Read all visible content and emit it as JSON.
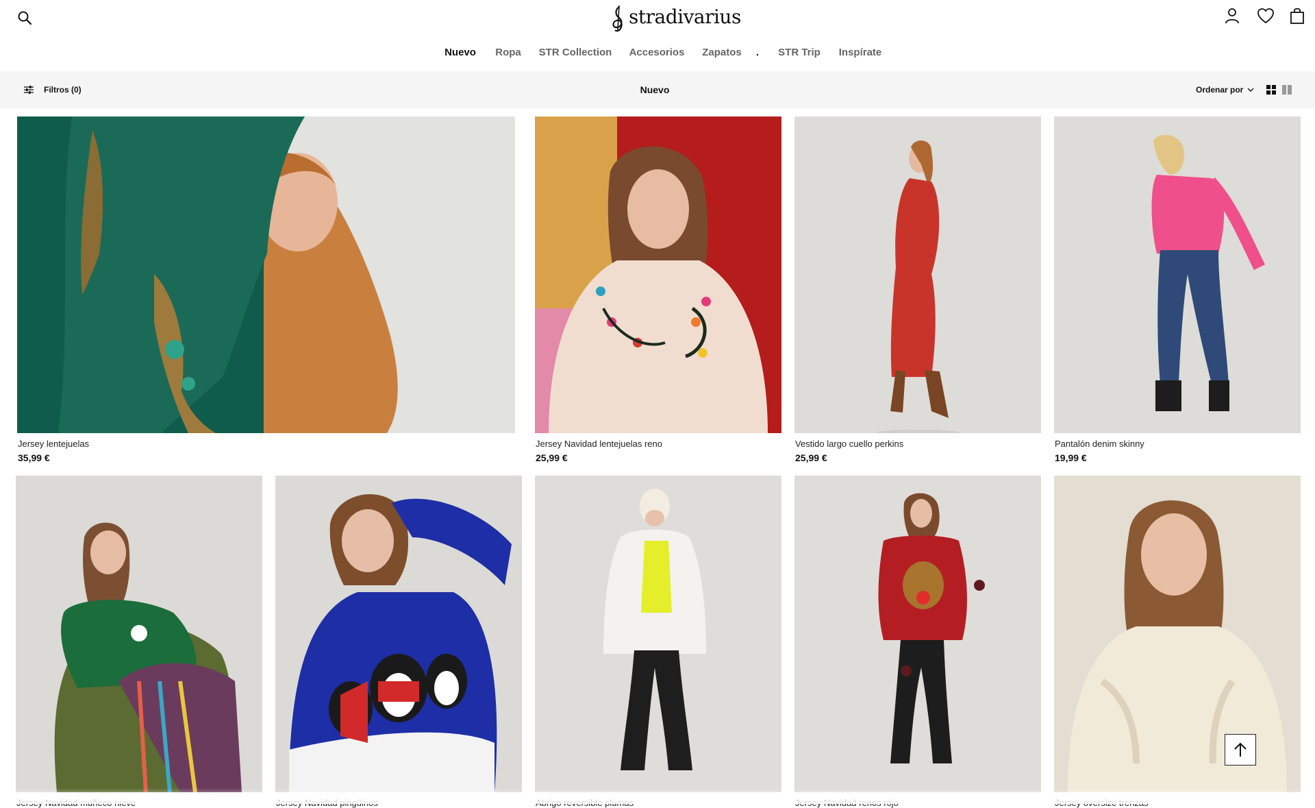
{
  "header": {
    "logo_text": "stradivarius",
    "icons": {
      "search": "search-icon",
      "account": "user-icon",
      "wishlist": "heart-icon",
      "cart": "bag-icon"
    }
  },
  "nav": {
    "items": [
      "Nuevo",
      "Ropa",
      "STR Collection",
      "Accesorios",
      "Zapatos",
      ".",
      "STR Trip",
      "Inspírate"
    ],
    "active": "Nuevo"
  },
  "filterbar": {
    "filters_label": "Filtros (0)",
    "title": "Nuevo",
    "sort_label": "Ordenar por"
  },
  "products": [
    {
      "name": "Jersey lentejuelas",
      "price": "35,99 €"
    },
    {
      "name": "Jersey Navidad lentejuelas reno",
      "price": "25,99 €"
    },
    {
      "name": "Vestido largo cuello perkins",
      "price": "25,99 €"
    },
    {
      "name": "Pantalón denim skinny",
      "price": "19,99 €"
    },
    {
      "name": "Jersey Navidad muñeco nieve",
      "price": ""
    },
    {
      "name": "Jersey Navidad pingüinos",
      "price": ""
    },
    {
      "name": "Abrigo reversible plumas",
      "price": ""
    },
    {
      "name": "Jersey Navidad renos rojo",
      "price": ""
    },
    {
      "name": "Jersey oversize trenzas",
      "price": ""
    }
  ],
  "colors": {
    "text": "#111111",
    "muted": "#666666",
    "filterbar_bg": "#f5f5f5"
  }
}
